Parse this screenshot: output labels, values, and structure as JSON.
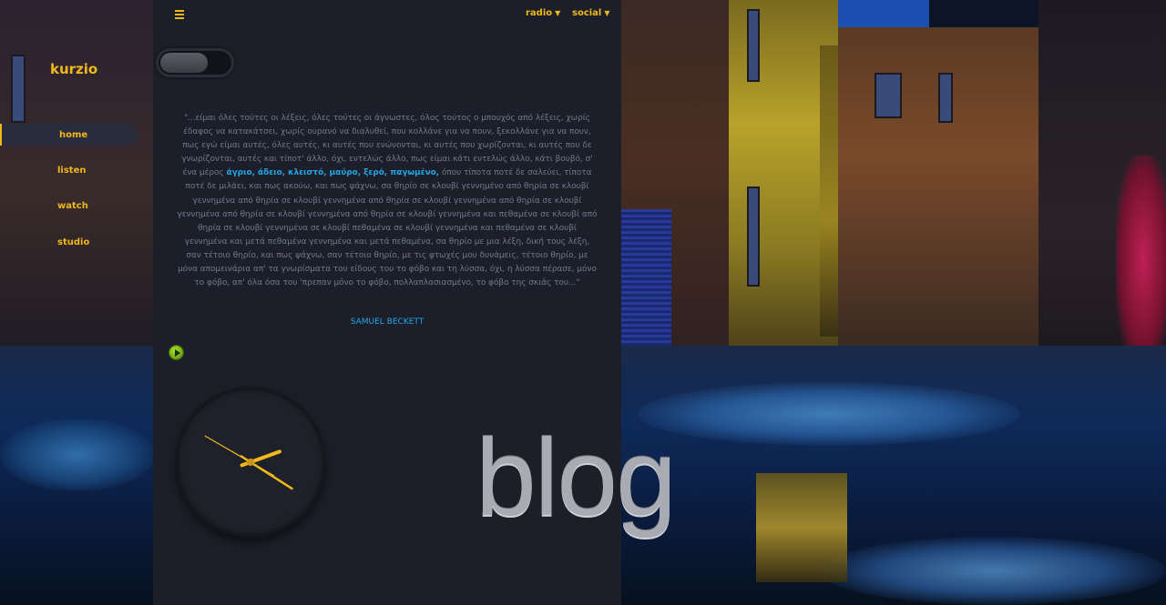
{
  "site": {
    "logo": "kurzio"
  },
  "sidebar": {
    "items": [
      {
        "label": "home",
        "active": true
      },
      {
        "label": "listen",
        "active": false
      },
      {
        "label": "watch",
        "active": false
      },
      {
        "label": "studio",
        "active": false
      }
    ]
  },
  "topbar": {
    "menu_icon": "hamburger-icon",
    "radio_label": "radio",
    "social_label": "social"
  },
  "quote": {
    "part1": "\"...είμαι όλες τούτες οι λέξεις, όλες τούτες οι άγνωστες, όλος τούτος ο μπουχός από λέξεις, χωρίς έδαφος να κατακάτσει, χωρίς ουρανό να διαλυθεί, που κολλάνε για να πουν, ξεκολλάνε για να πουν, πως εγώ είμαι αυτές, όλες αυτές, κι αυτές που ενώνονται, κι αυτές που χωρίζονται, κι αυτές που δε γνωρίζονται, αυτές και τίποτ' άλλο, όχι, εντελώς άλλο, πως είμαι κάτι εντελώς άλλο, κάτι βουβό, σ' ένα μέρος ",
    "highlight": "άγριο, άδειο, κλειστό, μαύρο, ξερό, παγωμένο,",
    "part2": " όπου τίποτα ποτέ δε σαλεύει, τίποτα ποτέ δε μιλάει, και πως ακούω, και πως ψάχνω, σα θηρίο σε κλουβί γεννημένο από θηρία σε κλουβί γεννημένα από θηρία σε κλουβί γεννημένα από θηρία σε κλουβί γεννημένα από θηρία σε κλουβί γεννημένα από θηρία σε κλουβί γεννημένα από θηρία σε κλουβί γεννημένα και πεθαμένα σε κλουβί από θηρία σε κλουβί γεννημένα σε κλουβί πεθαμένα σε κλουβί γεννημένα και πεθαμένα σε κλουβί γεννημένα και μετά πεθαμένα γεννημένα και μετά πεθαμένα, σα θηρίο με μια λέξη, δική τους λέξη, σαν τέτοιο θηρίο, και πως ψάχνω, σαν τέτοιο θηρίο, με τις φτωχές μου δυνάμεις, τέτοιο θηρίο, με μόνα απομεινάρια απ' τα γνωρίσματα του είδους του το φόβο και τη λύσσα, όχι, η λύσσα πέρασε, μόνο το φόβο, απ' όλα όσα του 'πρεπαν μόνο το φόβο, πολλαπλασιασμένο, το φόβο της σκιάς του...\"",
    "author": "SAMUEL BECKETT"
  },
  "player": {
    "icon": "play-icon"
  },
  "clock": {
    "hour": 2,
    "minute": 20,
    "second": 25
  },
  "hero": {
    "title": "blog"
  },
  "colors": {
    "accent": "#f0b81a",
    "link": "#22a6e8",
    "panel": "#1c1f2a",
    "quote_text": "#6f7a8a"
  }
}
